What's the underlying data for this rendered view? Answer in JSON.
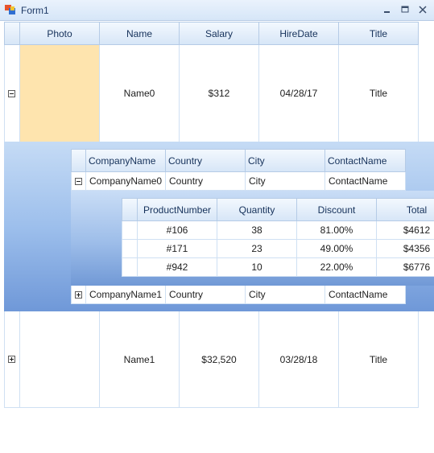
{
  "window": {
    "title": "Form1"
  },
  "main": {
    "columns": [
      "Photo",
      "Name",
      "Salary",
      "HireDate",
      "Title"
    ],
    "rows": [
      {
        "name": "Name0",
        "salary": "$312",
        "hire_date": "04/28/17",
        "title": "Title",
        "photo_color": "#fee4ae"
      },
      {
        "name": "Name1",
        "salary": "$32,520",
        "hire_date": "03/28/18",
        "title": "Title"
      }
    ]
  },
  "companies": {
    "columns": [
      "CompanyName",
      "Country",
      "City",
      "ContactName"
    ],
    "rows": [
      {
        "company": "CompanyName0",
        "country": "Country",
        "city": "City",
        "contact": "ContactName"
      },
      {
        "company": "CompanyName1",
        "country": "Country",
        "city": "City",
        "contact": "ContactName"
      }
    ]
  },
  "products": {
    "columns": [
      "ProductNumber",
      "Quantity",
      "Discount",
      "Total"
    ],
    "rows": [
      {
        "number": "#106",
        "quantity": "38",
        "discount": "81.00%",
        "total": "$4612"
      },
      {
        "number": "#171",
        "quantity": "23",
        "discount": "49.00%",
        "total": "$4356"
      },
      {
        "number": "#942",
        "quantity": "10",
        "discount": "22.00%",
        "total": "$6776"
      }
    ]
  },
  "colors": {
    "accent": "#6f98d8",
    "header_border": "#b5cbe6",
    "selected_photo": "#fee4ae"
  }
}
